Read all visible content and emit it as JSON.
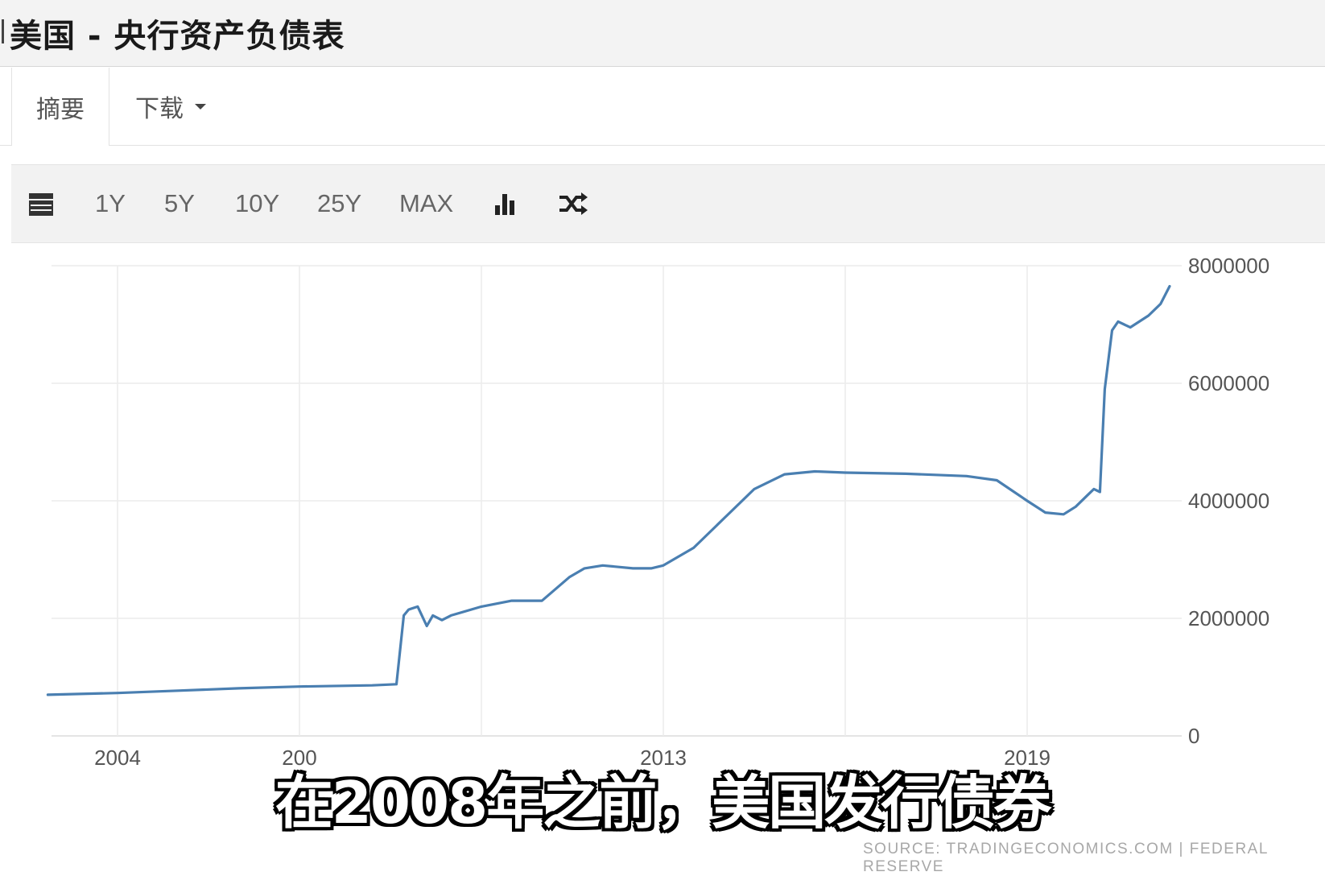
{
  "header": {
    "title": "美国 - 央行资产负债表"
  },
  "tabs": {
    "summary": "摘要",
    "download": "下载"
  },
  "toolbar": {
    "calendar_icon": "calendar-icon",
    "ranges": [
      "1Y",
      "5Y",
      "10Y",
      "25Y",
      "MAX"
    ],
    "bar_chart_icon": "bar-chart-icon",
    "shuffle_icon": "shuffle-icon"
  },
  "subtitle": "在2008年之前，美国发行债券",
  "source": "SOURCE: TRADINGECONOMICS.COM | FEDERAL RESERVE",
  "chart_data": {
    "type": "line",
    "title": "",
    "xlabel": "",
    "ylabel": "",
    "x_tick_labels": [
      "2004",
      "200",
      "2013",
      "2019"
    ],
    "y_ticks": [
      0,
      2000000,
      4000000,
      6000000,
      8000000
    ],
    "ylim": [
      0,
      8000000
    ],
    "xlim": [
      2002.8,
      2021.4
    ],
    "grid": true,
    "line_color": "#4a7fb1",
    "series": [
      {
        "x": [
          2002.85,
          2004,
          2005,
          2006,
          2007,
          2008.2,
          2008.6,
          2008.72,
          2008.8,
          2008.95,
          2009.1,
          2009.2,
          2009.35,
          2009.5,
          2010,
          2010.5,
          2011,
          2011.45,
          2011.7,
          2012,
          2012.5,
          2012.8,
          2013,
          2013.5,
          2014,
          2014.5,
          2015,
          2015.5,
          2016,
          2017,
          2018,
          2018.5,
          2019,
          2019.3,
          2019.6,
          2019.8,
          2020,
          2020.1,
          2020.2,
          2020.28,
          2020.4,
          2020.5,
          2020.7,
          2021,
          2021.2,
          2021.35
        ],
        "y": [
          700000,
          730000,
          770000,
          810000,
          840000,
          860000,
          880000,
          2050000,
          2150000,
          2200000,
          1870000,
          2050000,
          1970000,
          2050000,
          2200000,
          2300000,
          2300000,
          2700000,
          2850000,
          2900000,
          2850000,
          2850000,
          2900000,
          3200000,
          3700000,
          4200000,
          4450000,
          4500000,
          4480000,
          4460000,
          4420000,
          4350000,
          4000000,
          3800000,
          3770000,
          3900000,
          4100000,
          4200000,
          4150000,
          5900000,
          6900000,
          7050000,
          6950000,
          7150000,
          7350000,
          7650000
        ]
      }
    ]
  }
}
